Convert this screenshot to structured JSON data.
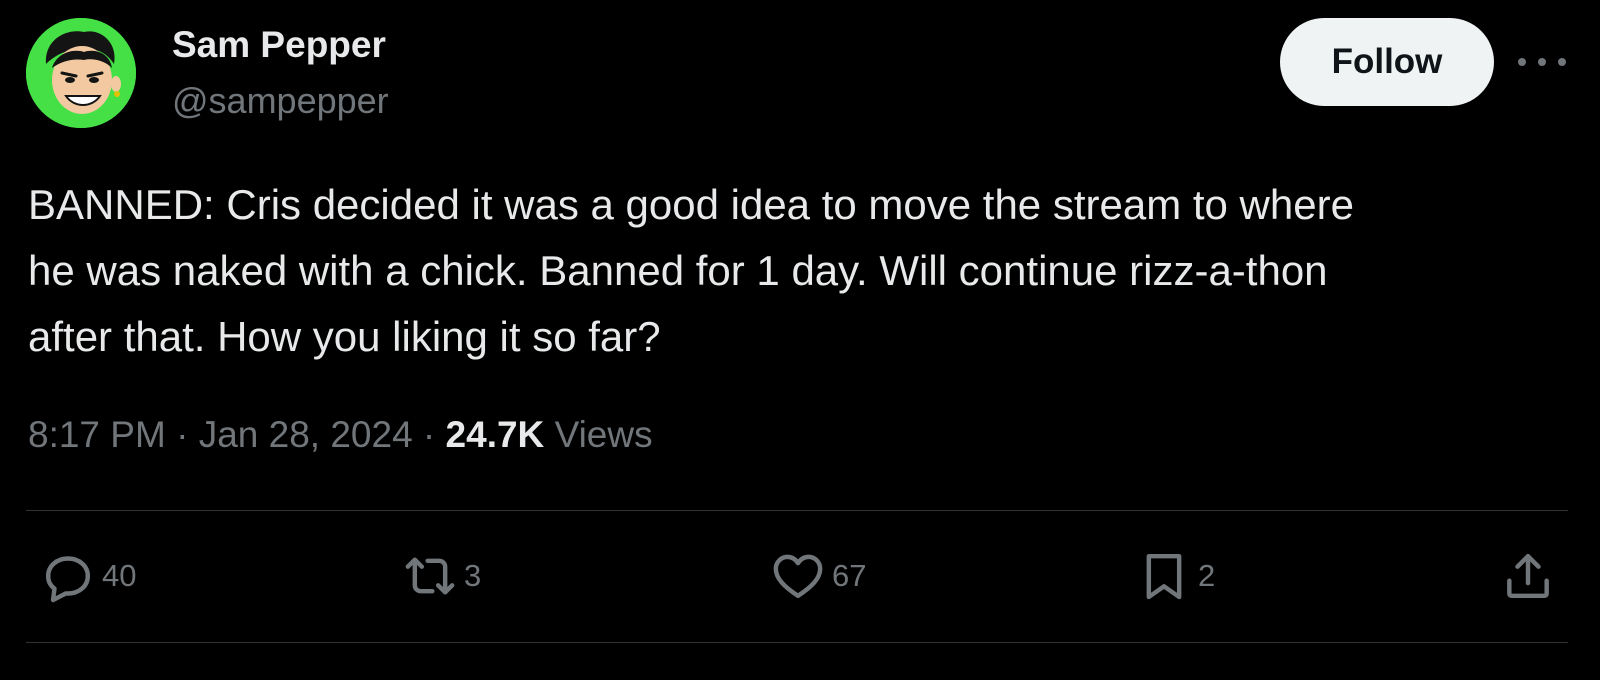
{
  "user": {
    "display_name": "Sam Pepper",
    "handle": "@sampepper",
    "avatar_icon": "cartoon-avatar-icon",
    "avatar_bg": "#45e045"
  },
  "header": {
    "follow_label": "Follow",
    "more_icon": "more-horizontal-icon"
  },
  "tweet": {
    "lines": [
      "BANNED: Cris decided it was a good idea to move the stream to where",
      "he was naked with a chick. Banned for 1 day. Will continue rizz-a-thon",
      "after that. How you liking it so far?"
    ]
  },
  "meta": {
    "time": "8:17 PM",
    "separator": " · ",
    "date": "Jan 28, 2024",
    "views_count": "24.7K",
    "views_label": "Views"
  },
  "actions": {
    "reply": {
      "icon": "reply-icon",
      "count": "40"
    },
    "retweet": {
      "icon": "retweet-icon",
      "count": "3"
    },
    "like": {
      "icon": "heart-icon",
      "count": "67"
    },
    "bookmark": {
      "icon": "bookmark-icon",
      "count": "2"
    },
    "share": {
      "icon": "share-icon"
    }
  },
  "colors": {
    "background": "#000000",
    "text_primary": "#e7e9ea",
    "text_secondary": "#71767b",
    "divider": "#2f3336",
    "follow_button_bg": "#eff3f4",
    "follow_button_text": "#0f1419"
  }
}
